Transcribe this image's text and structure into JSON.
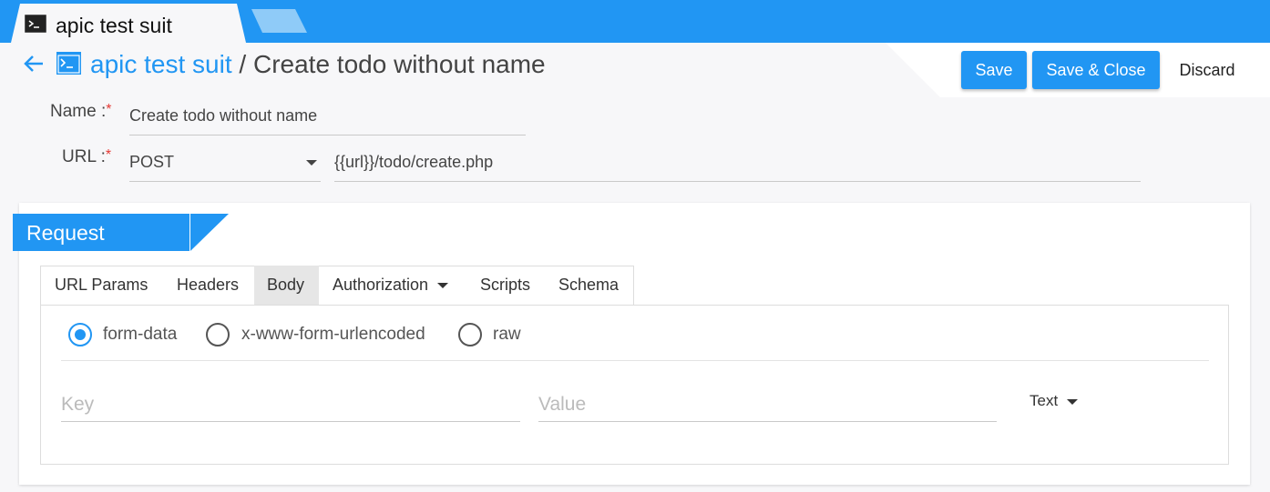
{
  "tabbar": {
    "active_tab": {
      "title": "apic test suit",
      "icon": "terminal-icon"
    },
    "new_tab_icon": "new-tab-icon"
  },
  "header": {
    "back_icon": "arrow-left-icon",
    "suite_icon": "terminal-icon",
    "suite_name": "apic test suit",
    "separator": " / ",
    "page_title": "Create todo without name"
  },
  "actions": {
    "save": "Save",
    "save_close": "Save & Close",
    "discard": "Discard"
  },
  "form": {
    "name_label": "Name :",
    "url_label": "URL :",
    "required_mark": "*",
    "name_value": "Create todo without name",
    "method": "POST",
    "url_value": "{{url}}/todo/create.php"
  },
  "request": {
    "title": "Request",
    "tabs": [
      "URL Params",
      "Headers",
      "Body",
      "Authorization",
      "Scripts",
      "Schema"
    ],
    "active_tab": "Body",
    "body_types": [
      "form-data",
      "x-www-form-urlencoded",
      "raw"
    ],
    "selected_body_type": "form-data",
    "key_placeholder": "Key",
    "value_placeholder": "Value",
    "field_type": "Text"
  },
  "colors": {
    "accent": "#2196f3",
    "required": "#e53935"
  }
}
